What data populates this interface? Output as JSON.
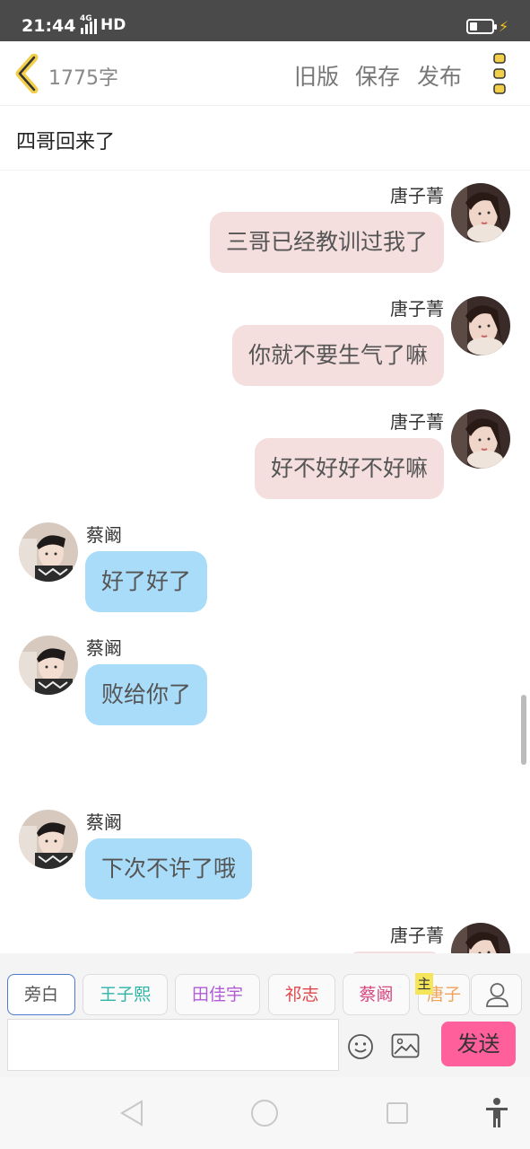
{
  "status_bar": {
    "time": "21:44",
    "network_gen": "4G",
    "network_label": "HD"
  },
  "header": {
    "word_count": "1775字",
    "old_version": "旧版",
    "save": "保存",
    "publish": "发布"
  },
  "story_title": "四哥回来了",
  "messages": [
    {
      "side": "right",
      "name": "唐子菁",
      "text": "三哥已经教训过我了"
    },
    {
      "side": "right",
      "name": "唐子菁",
      "text": "你就不要生气了嘛"
    },
    {
      "side": "right",
      "name": "唐子菁",
      "text": "好不好好不好嘛"
    },
    {
      "side": "left",
      "name": "蔡阚",
      "text": "好了好了"
    },
    {
      "side": "left",
      "name": "蔡阚",
      "text": "败给你了"
    },
    {
      "side": "left",
      "name": "蔡阚",
      "text": "下次不许了哦"
    },
    {
      "side": "right",
      "name": "唐子菁",
      "text": ""
    }
  ],
  "roles": [
    {
      "label": "旁白",
      "color": "#555555"
    },
    {
      "label": "王子熙",
      "color": "#2bb5a6"
    },
    {
      "label": "田佳宇",
      "color": "#b35bd6"
    },
    {
      "label": "祁志",
      "color": "#e0454a"
    },
    {
      "label": "蔡阚",
      "color": "#d6477f"
    },
    {
      "label": "唐子",
      "color": "#f0a35a"
    }
  ],
  "owner_badge": "主",
  "send_label": "发送",
  "colors": {
    "accent_send": "#ff5f9b",
    "bubble_right": "#f4dede",
    "bubble_left": "#a9dcf9",
    "back_chevron": "#f2cf4a"
  }
}
